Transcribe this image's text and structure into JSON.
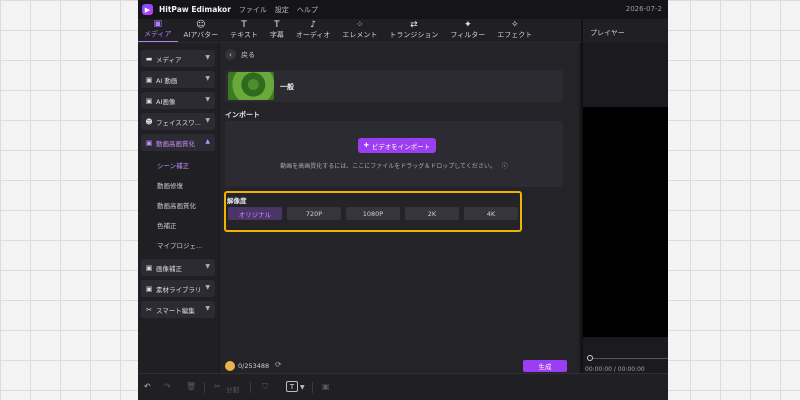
{
  "titlebar": {
    "app_name": "HitPaw Edimakor",
    "menus": [
      "ファイル",
      "設定",
      "ヘルプ"
    ],
    "date": "2026-07-2"
  },
  "toolbar": {
    "tabs": [
      {
        "icon": "media-icon",
        "glyph": "▣",
        "label": "メディア",
        "active": true
      },
      {
        "icon": "ai-avatar-icon",
        "glyph": "☺",
        "label": "AIアバター"
      },
      {
        "icon": "text-icon",
        "glyph": "T",
        "label": "テキスト"
      },
      {
        "icon": "subtitle-icon",
        "glyph": "T",
        "label": "字幕"
      },
      {
        "icon": "audio-icon",
        "glyph": "♪",
        "label": "オーディオ"
      },
      {
        "icon": "element-icon",
        "glyph": "⁘",
        "label": "エレメント"
      },
      {
        "icon": "transition-icon",
        "glyph": "⇄",
        "label": "トランジション"
      },
      {
        "icon": "filter-icon",
        "glyph": "✦",
        "label": "フィルター"
      },
      {
        "icon": "effect-icon",
        "glyph": "✧",
        "label": "エフェクト"
      }
    ]
  },
  "player": {
    "title": "プレイヤー",
    "timecode": "00:00:00 / 00:00:00"
  },
  "sidebar": {
    "items": [
      {
        "icon": "folder-icon",
        "glyph": "▬",
        "label": "メディア",
        "chevron": "▼"
      },
      {
        "icon": "ai-video-icon",
        "glyph": "▣",
        "label": "AI 動画",
        "chevron": "▼"
      },
      {
        "icon": "ai-image-icon",
        "glyph": "▣",
        "label": "AI画像",
        "chevron": "▼"
      },
      {
        "icon": "face-swap-icon",
        "glyph": "☻",
        "label": "フェイススワ...",
        "chevron": "▼"
      },
      {
        "icon": "video-enhance-icon",
        "glyph": "▣",
        "label": "動画高画質化",
        "chevron": "▲",
        "open": true
      }
    ],
    "sub_items": [
      {
        "label": "シーン補正",
        "active": true
      },
      {
        "label": "動画修復"
      },
      {
        "label": "動画高画質化"
      },
      {
        "label": "色補正"
      },
      {
        "label": "マイプロジェ..."
      }
    ],
    "items_after": [
      {
        "icon": "image-enhance-icon",
        "glyph": "▣",
        "label": "画像補正",
        "chevron": "▼"
      },
      {
        "icon": "asset-library-icon",
        "glyph": "▣",
        "label": "素材ライブラリ",
        "chevron": "▼"
      },
      {
        "icon": "smart-edit-icon",
        "glyph": "✂",
        "label": "スマート編集",
        "chevron": "▼"
      }
    ]
  },
  "main": {
    "back_label": "戻る",
    "general_label": "一般",
    "import_title": "インポート",
    "import_button": "ビデオをインポート",
    "import_hint": "動画を高画質化するには、ここにファイルをドラッグ＆ドロップしてください。",
    "resolution_title": "解像度",
    "resolutions": [
      "オリジナル",
      "720P",
      "1080P",
      "2K",
      "4K"
    ],
    "selected_resolution": "オリジナル",
    "credits": "0/253488",
    "generate_button": "生成"
  },
  "timeline": {
    "split_label": "分割",
    "text_tool": "T"
  }
}
